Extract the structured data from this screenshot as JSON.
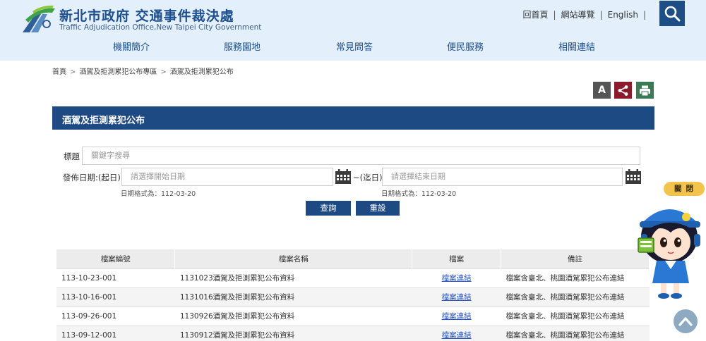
{
  "header": {
    "title_zh": "新北市政府 交通事件裁決處",
    "title_en": "Traffic Adjudication Office,New Taipei City Government",
    "links": [
      "回首頁",
      "網站導覽",
      "English"
    ],
    "search_icon": "search-icon"
  },
  "nav": [
    "機關簡介",
    "服務園地",
    "常見問答",
    "便民服務",
    "相關連結"
  ],
  "breadcrumb": [
    "首頁",
    "酒駕及拒測累犯公布專區",
    "酒駕及拒測累犯公布"
  ],
  "tools": {
    "font_label": "A",
    "share_icon": "share-icon",
    "print_icon": "print-icon"
  },
  "section": {
    "title": "酒駕及拒測累犯公布"
  },
  "form": {
    "keyword_label": "標題",
    "keyword_placeholder": "關鍵字搜尋",
    "date_label": "發佈日期:(起日)",
    "date_to_label": "~(迄日)",
    "start_placeholder": "請選擇開始日期",
    "end_placeholder": "請選擇結束日期",
    "date_hint": "日期格式為：112-03-20",
    "search_label": "查詢",
    "reset_label": "重設"
  },
  "table": {
    "headers": [
      "檔案編號",
      "檔案名稱",
      "檔案",
      "備註"
    ],
    "rows": [
      [
        "113-10-23-001",
        "1131023酒駕及拒測累犯公布資料",
        "檔案連結",
        "檔案含臺北、桃園酒駕累犯公布連結"
      ],
      [
        "113-10-16-001",
        "1131016酒駕及拒測累犯公布資料",
        "檔案連結",
        "檔案含臺北、桃園酒駕累犯公布連結"
      ],
      [
        "113-09-26-001",
        "1130926酒駕及拒測累犯公布資料",
        "檔案連結",
        "檔案含臺北、桃園酒駕累犯公布連結"
      ],
      [
        "113-09-12-001",
        "1130912酒駕及拒測累犯公布資料",
        "檔案連結",
        "檔案含臺北、桃園酒駕累犯公布連結"
      ]
    ]
  },
  "mascot": {
    "close_label": "關閉"
  },
  "colors": {
    "header_bg": "#e3f0fb",
    "brand_blue": "#1d4a82",
    "share_red": "#8c1a2a",
    "print_green": "#3a7a55",
    "link_blue": "#2a56c6"
  }
}
